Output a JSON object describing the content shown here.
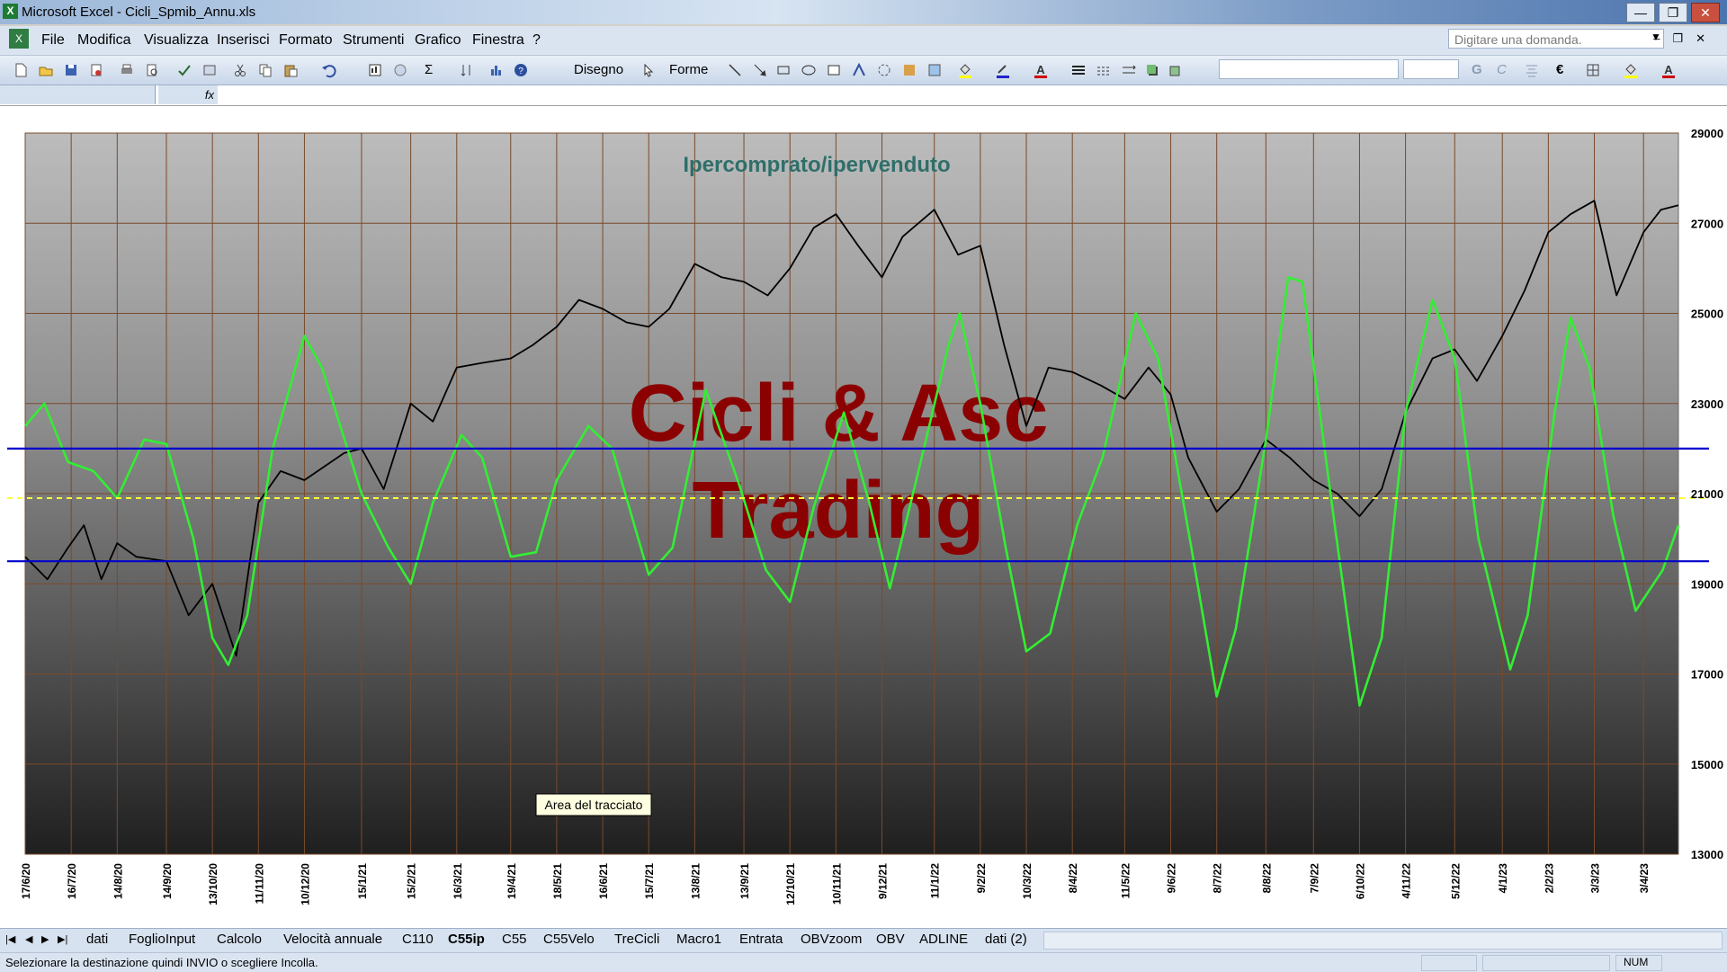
{
  "window": {
    "title": "Microsoft Excel - Cicli_Spmib_Annu.xls"
  },
  "menu": [
    "File",
    "Modifica",
    "Visualizza",
    "Inserisci",
    "Formato",
    "Strumenti",
    "Grafico",
    "Finestra",
    "?"
  ],
  "ask_placeholder": "Digitare una domanda.",
  "toolbar": {
    "drawing": "Disegno",
    "shapes": "Forme"
  },
  "formula_bar": {
    "fx": "fx"
  },
  "sheet_tabs": [
    "dati",
    "FoglioInput",
    "Calcolo",
    "Velocità annuale",
    "C110",
    "C55ip",
    "C55",
    "C55Velo",
    "TreCicli",
    "Macro1",
    "Entrata",
    "OBVzoom",
    "OBV",
    "ADLINE",
    "dati (2)"
  ],
  "active_tab": "C55ip",
  "status": {
    "message": "Selezionare la destinazione quindi INVIO o scegliere Incolla.",
    "num": "NUM"
  },
  "colors": {
    "price": "#000000",
    "oscillator": "#33ee33",
    "band": "#0000cc",
    "midline": "#ffff33",
    "watermark": "#8b0000",
    "chart_title": "#2f6f6a"
  },
  "chart_data": {
    "type": "line",
    "title": "Ipercomprato/ipervenduto",
    "watermark": [
      "Cicli & Asc",
      "Trading"
    ],
    "tooltip": "Area del tracciato",
    "ylim": [
      13000,
      29000
    ],
    "yticks": [
      13000,
      15000,
      17000,
      19000,
      21000,
      23000,
      25000,
      27000,
      29000
    ],
    "xlim": [
      "17/6/20",
      "25/4/23"
    ],
    "xticks": [
      "17/6/20",
      "16/7/20",
      "14/8/20",
      "14/9/20",
      "13/10/20",
      "11/11/20",
      "10/12/20",
      "15/1/21",
      "15/2/21",
      "16/3/21",
      "19/4/21",
      "18/5/21",
      "16/6/21",
      "15/7/21",
      "13/8/21",
      "13/9/21",
      "12/10/21",
      "10/11/21",
      "9/12/21",
      "11/1/22",
      "9/2/22",
      "10/3/22",
      "8/4/22",
      "11/5/22",
      "9/6/22",
      "8/7/22",
      "8/8/22",
      "7/9/22",
      "6/10/22",
      "4/11/22",
      "5/12/22",
      "4/1/23",
      "2/2/23",
      "3/3/23",
      "3/4/23"
    ],
    "grid": true,
    "series": [
      {
        "kind": "price",
        "points": [
          [
            "17/6/20",
            19600
          ],
          [
            "1/7/20",
            19100
          ],
          [
            "14/7/20",
            19800
          ],
          [
            "24/7/20",
            20300
          ],
          [
            "4/8/20",
            19100
          ],
          [
            "14/8/20",
            19900
          ],
          [
            "26/8/20",
            19600
          ],
          [
            "14/9/20",
            19500
          ],
          [
            "28/9/20",
            18300
          ],
          [
            "13/10/20",
            19000
          ],
          [
            "28/10/20",
            17400
          ],
          [
            "11/11/20",
            20800
          ],
          [
            "25/11/20",
            21500
          ],
          [
            "10/12/20",
            21300
          ],
          [
            "4/1/21",
            21900
          ],
          [
            "15/1/21",
            22000
          ],
          [
            "29/1/21",
            21100
          ],
          [
            "15/2/21",
            23000
          ],
          [
            "1/3/21",
            22600
          ],
          [
            "16/3/21",
            23800
          ],
          [
            "1/4/21",
            23900
          ],
          [
            "19/4/21",
            24000
          ],
          [
            "3/5/21",
            24300
          ],
          [
            "18/5/21",
            24700
          ],
          [
            "1/6/21",
            25300
          ],
          [
            "16/6/21",
            25100
          ],
          [
            "1/7/21",
            24800
          ],
          [
            "15/7/21",
            24700
          ],
          [
            "28/7/21",
            25100
          ],
          [
            "13/8/21",
            26100
          ],
          [
            "30/8/21",
            25800
          ],
          [
            "13/9/21",
            25700
          ],
          [
            "28/9/21",
            25400
          ],
          [
            "12/10/21",
            26000
          ],
          [
            "27/10/21",
            26900
          ],
          [
            "10/11/21",
            27200
          ],
          [
            "24/11/21",
            26500
          ],
          [
            "9/12/21",
            25800
          ],
          [
            "22/12/21",
            26700
          ],
          [
            "11/1/22",
            27300
          ],
          [
            "26/1/22",
            26300
          ],
          [
            "9/2/22",
            26500
          ],
          [
            "24/2/22",
            24300
          ],
          [
            "10/3/22",
            22500
          ],
          [
            "24/3/22",
            23800
          ],
          [
            "8/4/22",
            23700
          ],
          [
            "26/4/22",
            23400
          ],
          [
            "11/5/22",
            23100
          ],
          [
            "26/5/22",
            23800
          ],
          [
            "9/6/22",
            23200
          ],
          [
            "20/6/22",
            21800
          ],
          [
            "8/7/22",
            20600
          ],
          [
            "22/7/22",
            21100
          ],
          [
            "8/8/22",
            22200
          ],
          [
            "23/8/22",
            21800
          ],
          [
            "7/9/22",
            21300
          ],
          [
            "22/9/22",
            21000
          ],
          [
            "6/10/22",
            20500
          ],
          [
            "20/10/22",
            21100
          ],
          [
            "4/11/22",
            22800
          ],
          [
            "21/11/22",
            24000
          ],
          [
            "5/12/22",
            24200
          ],
          [
            "19/12/22",
            23500
          ],
          [
            "4/1/23",
            24500
          ],
          [
            "18/1/23",
            25500
          ],
          [
            "2/2/23",
            26800
          ],
          [
            "16/2/23",
            27200
          ],
          [
            "3/3/23",
            27500
          ],
          [
            "17/3/23",
            25400
          ],
          [
            "3/4/23",
            26800
          ],
          [
            "14/4/23",
            27300
          ],
          [
            "25/4/23",
            27400
          ]
        ]
      },
      {
        "kind": "oscillator",
        "points": [
          [
            "17/6/20",
            22500
          ],
          [
            "29/6/20",
            23000
          ],
          [
            "14/7/20",
            21700
          ],
          [
            "30/7/20",
            21500
          ],
          [
            "14/8/20",
            20900
          ],
          [
            "31/8/20",
            22200
          ],
          [
            "14/9/20",
            22100
          ],
          [
            "1/10/20",
            20000
          ],
          [
            "13/10/20",
            17800
          ],
          [
            "23/10/20",
            17200
          ],
          [
            "4/11/20",
            18300
          ],
          [
            "20/11/20",
            22000
          ],
          [
            "10/12/20",
            24500
          ],
          [
            "21/12/20",
            23800
          ],
          [
            "15/1/21",
            21000
          ],
          [
            "1/2/21",
            19800
          ],
          [
            "15/2/21",
            19000
          ],
          [
            "1/3/21",
            20800
          ],
          [
            "19/3/21",
            22300
          ],
          [
            "1/4/21",
            21800
          ],
          [
            "19/4/21",
            19600
          ],
          [
            "5/5/21",
            19700
          ],
          [
            "18/5/21",
            21300
          ],
          [
            "7/6/21",
            22500
          ],
          [
            "22/6/21",
            22000
          ],
          [
            "15/7/21",
            19200
          ],
          [
            "30/7/21",
            19800
          ],
          [
            "20/8/21",
            23300
          ],
          [
            "10/9/21",
            21200
          ],
          [
            "27/9/21",
            19300
          ],
          [
            "12/10/21",
            18600
          ],
          [
            "27/10/21",
            20700
          ],
          [
            "15/11/21",
            22800
          ],
          [
            "1/12/21",
            20800
          ],
          [
            "14/12/21",
            18900
          ],
          [
            "1/1/22",
            21500
          ],
          [
            "20/1/22",
            24300
          ],
          [
            "27/1/22",
            25000
          ],
          [
            "9/2/22",
            23000
          ],
          [
            "25/2/22",
            19800
          ],
          [
            "10/3/22",
            17500
          ],
          [
            "25/3/22",
            17900
          ],
          [
            "11/4/22",
            20300
          ],
          [
            "27/4/22",
            21800
          ],
          [
            "18/5/22",
            25000
          ],
          [
            "1/6/22",
            24000
          ],
          [
            "22/6/22",
            19800
          ],
          [
            "8/7/22",
            16500
          ],
          [
            "20/7/22",
            18000
          ],
          [
            "8/8/22",
            22200
          ],
          [
            "22/8/22",
            25800
          ],
          [
            "31/8/22",
            25700
          ],
          [
            "20/9/22",
            20400
          ],
          [
            "6/10/22",
            16300
          ],
          [
            "20/10/22",
            17800
          ],
          [
            "4/11/22",
            22800
          ],
          [
            "21/11/22",
            25300
          ],
          [
            "5/12/22",
            24000
          ],
          [
            "20/12/22",
            20000
          ],
          [
            "9/1/23",
            17100
          ],
          [
            "20/1/23",
            18300
          ],
          [
            "6/2/23",
            22800
          ],
          [
            "16/2/23",
            24900
          ],
          [
            "28/2/23",
            23800
          ],
          [
            "15/3/23",
            20500
          ],
          [
            "29/3/23",
            18400
          ],
          [
            "15/4/23",
            19300
          ],
          [
            "25/4/23",
            20300
          ]
        ]
      },
      {
        "kind": "band",
        "value": 22000
      },
      {
        "kind": "band",
        "value": 19500
      },
      {
        "kind": "midline",
        "value": 20900
      }
    ]
  }
}
